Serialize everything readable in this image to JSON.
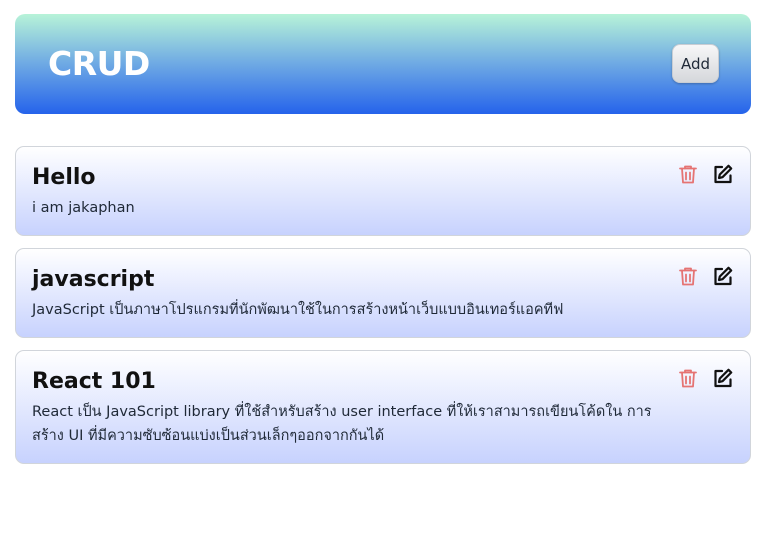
{
  "header": {
    "title": "CRUD",
    "add_label": "Add"
  },
  "posts": [
    {
      "title": "Hello",
      "description": "i am jakaphan"
    },
    {
      "title": "javascript",
      "description": "JavaScript เป็นภาษาโปรแกรมที่นักพัฒนาใช้ในการสร้างหน้าเว็บแบบอินเทอร์แอคทีฟ"
    },
    {
      "title": "React 101",
      "description": "React เป็น JavaScript library ที่ใช้สำหรับสร้าง user interface ที่ให้เราสามารถเขียนโค้ดใน การสร้าง UI ที่มีความซับซ้อนแบ่งเป็นส่วนเล็กๆออกจากกันได้"
    }
  ],
  "icons": {
    "delete": "trash-icon",
    "edit": "edit-icon"
  },
  "colors": {
    "delete_icon": "#e57373",
    "edit_icon": "#111111",
    "header_gradient_top": "#b7f3d8",
    "header_gradient_bottom": "#2563eb",
    "card_gradient_bottom": "#c7d2fe"
  }
}
